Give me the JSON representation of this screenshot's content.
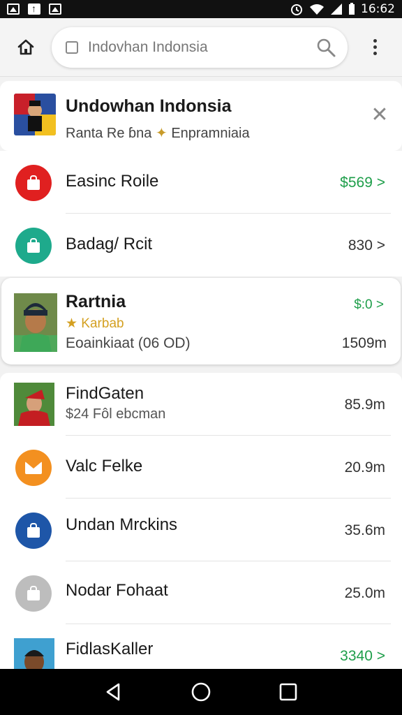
{
  "status_bar": {
    "time": "16:62"
  },
  "toolbar": {
    "search_text": "Indovhan Indonsia",
    "search_placeholder": "Search"
  },
  "header_card": {
    "title": "Undowhan Indonsia",
    "subtitle_left": "Ranta Re ɓna",
    "subtitle_star": "✦",
    "subtitle_right": "Enpramniaia",
    "thumb_icon": "flag-collage-icon"
  },
  "list1": [
    {
      "label": "Easinc Roile",
      "value": "$569 >",
      "color": "#e02020",
      "value_color": "green",
      "icon": "shopping-bag-icon"
    },
    {
      "label": "Badag/ Rcit",
      "value": "830 >",
      "color": "#1eaa8c",
      "value_color": "gray",
      "icon": "shopping-bag-icon"
    }
  ],
  "person_card": {
    "name": "Rartnia",
    "rating": "★ Karbab",
    "subtitle": "Eoainkiaat (06 OD)",
    "value": "$:0 >",
    "distance": "1509m"
  },
  "list2": [
    {
      "label": "FindGaten",
      "sublabel": "$24 Fôl ebcman",
      "value": "85.9m",
      "type": "photo"
    },
    {
      "label": "Valc Felke",
      "sublabel": "",
      "value": "20.9m",
      "type": "icon",
      "color": "#f39020"
    },
    {
      "label": "Undan Mrckins",
      "sublabel": "",
      "value": "35.6m",
      "type": "icon",
      "color": "#1e56a8"
    },
    {
      "label": "Nodar Fohaat",
      "sublabel": "",
      "value": "25.0m",
      "type": "icon",
      "color": "#bdbdbd"
    },
    {
      "label": "FidlasKaller",
      "sublabel": "",
      "value": "3340 >",
      "type": "photo",
      "value_color": "green"
    }
  ],
  "navbar": {
    "back": "back-icon",
    "home": "home-circle-icon",
    "recents": "recents-icon"
  }
}
